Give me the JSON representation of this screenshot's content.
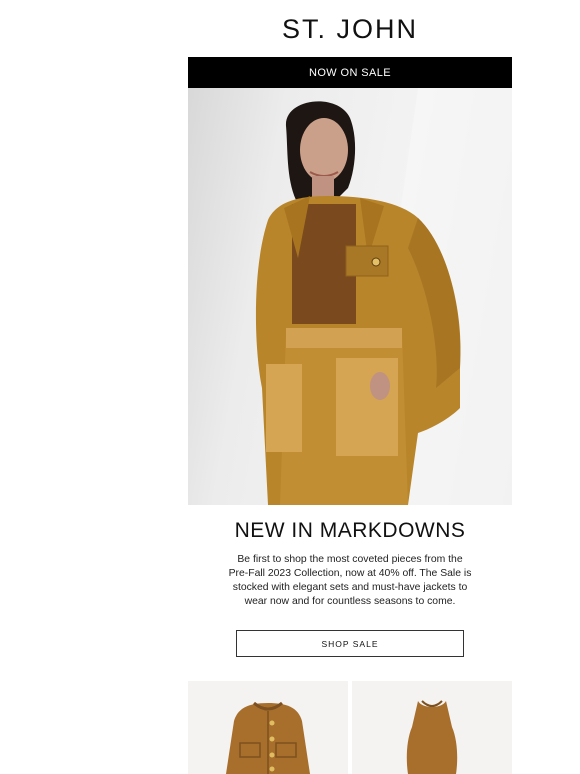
{
  "brand": {
    "logo_text": "ST. JOHN"
  },
  "banner": {
    "label": "NOW ON SALE"
  },
  "hero": {
    "alt": "Model wearing camel suede jacket and skirt"
  },
  "section": {
    "headline": "NEW IN MARKDOWNS",
    "body": "Be first to shop the most coveted pieces from the Pre-Fall 2023 Collection, now at 40% off. The Sale is stocked with elegant sets and must-have jackets to wear now and for countless seasons to come.",
    "cta_label": "SHOP SALE"
  },
  "products": [
    {
      "icon": "knit-jacket-image"
    },
    {
      "icon": "knit-dress-image"
    }
  ],
  "colors": {
    "banner_bg": "#000000",
    "suede": "#b9852a",
    "knit": "#a86f2c"
  }
}
